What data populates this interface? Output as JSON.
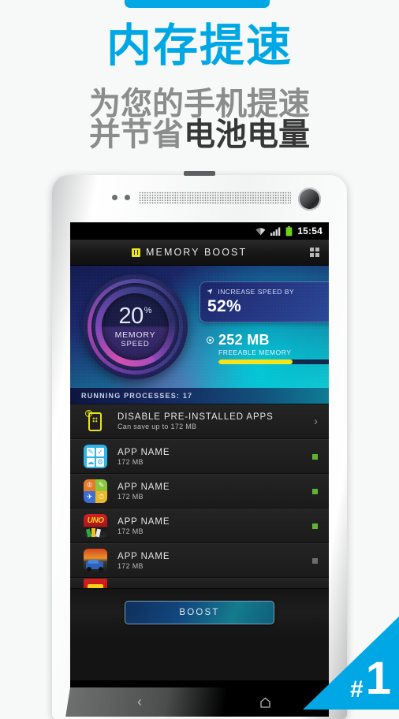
{
  "promo": {
    "title": "内存提速",
    "subtitle_line1": "为您的手机提速",
    "subtitle_line2_gray": "并节省",
    "subtitle_line2_dark": "电池电量",
    "accent_color": "#00a7e5",
    "subtitle_gray_color": "#8b8c8c",
    "subtitle_dark_color": "#373737"
  },
  "badge": {
    "hash": "#",
    "number": "1"
  },
  "phone": {
    "status_bar": {
      "wifi_icon": "wifi-icon",
      "signal_icon": "signal-icon",
      "battery_icon": "battery-icon",
      "battery_color": "#6fd01d",
      "time": "15:54"
    },
    "app_header": {
      "logo_icon": "app-logo-icon",
      "title": "MEMORY BOOST",
      "menu_icon": "grid-menu-icon"
    },
    "dashboard": {
      "gauge": {
        "value": "20",
        "unit": "%",
        "label_line1": "MEMORY",
        "label_line2": "SPEED"
      },
      "speed_card": {
        "icon": "rocket-icon",
        "label": "INCREASE SPEED BY",
        "value": "52%"
      },
      "memory": {
        "icon": "record-dot-icon",
        "value": "252 MB",
        "label": "FREEABLE MEMORY",
        "bar_percent": 65,
        "bar_color": "#f2e31c"
      }
    },
    "running_bar": {
      "text": "RUNNING PROCESSES: 17"
    },
    "disable_row": {
      "icon": "disable-apps-icon",
      "title": "DISABLE PRE-INSTALLED APPS",
      "subtitle": "Can save up to 172 MB",
      "chevron": "›"
    },
    "app_rows": [
      {
        "icon": "app-icon-tools",
        "title": "APP NAME",
        "size": "172 MB",
        "checked": true,
        "check_color": "#5fb335"
      },
      {
        "icon": "app-icon-quad",
        "title": "APP NAME",
        "size": "172 MB",
        "checked": true,
        "check_color": "#5fb335"
      },
      {
        "icon": "app-icon-uno",
        "title": "APP NAME",
        "size": "172 MB",
        "checked": true,
        "check_color": "#5fb335"
      },
      {
        "icon": "app-icon-racing",
        "title": "APP NAME",
        "size": "172 MB",
        "checked": false,
        "check_color": "#6d6d6d"
      }
    ],
    "boost_button": {
      "label": "BOOST"
    },
    "nav_bar": {
      "back_icon": "back-chevron-icon",
      "home_icon": "home-icon"
    }
  }
}
